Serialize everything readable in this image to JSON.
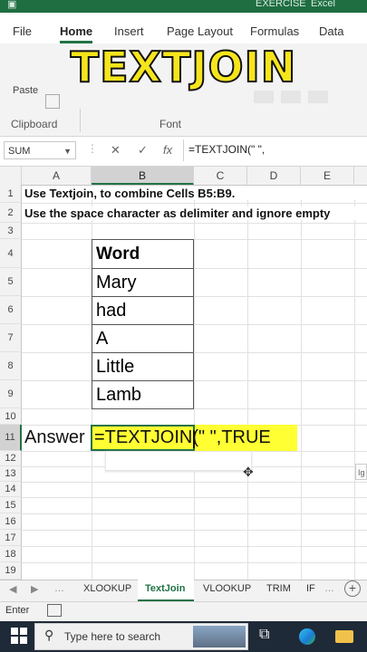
{
  "titlebar": {
    "filename": "EXERCISE",
    "app": "Excel"
  },
  "ribbon": {
    "tabs": [
      "File",
      "Home",
      "Insert",
      "Page Layout",
      "Formulas",
      "Data"
    ],
    "banner": "TEXTJOIN",
    "paste_label": "Paste",
    "groups": {
      "clipboard": "Clipboard",
      "font": "Font"
    }
  },
  "formula_bar": {
    "name_box": "SUM",
    "cancel": "✕",
    "enter": "✓",
    "fx": "fx",
    "formula": "=TEXTJOIN(\" \","
  },
  "grid": {
    "columns": [
      "A",
      "B",
      "C",
      "D",
      "E"
    ],
    "rows": [
      "1",
      "2",
      "3",
      "4",
      "5",
      "6",
      "7",
      "8",
      "9",
      "10",
      "11",
      "12",
      "13",
      "14",
      "15",
      "16",
      "17",
      "18",
      "19"
    ],
    "row1": "Use Textjoin, to combine Cells B5:B9.",
    "row2": "Use the space character as delimiter and ignore empty",
    "header": "Word",
    "words": [
      "Mary",
      "had",
      "A",
      "Little",
      "Lamb"
    ],
    "answer_label": "Answer",
    "answer_formula": "=TEXTJOIN(\" \",TRUE",
    "tooltip_hint": "Ig"
  },
  "sheets": {
    "tabs": [
      "XLOOKUP",
      "TextJoin",
      "VLOOKUP",
      "TRIM",
      "IF"
    ],
    "active": "TextJoin"
  },
  "status": {
    "mode": "Enter"
  },
  "taskbar": {
    "search_placeholder": "Type here to search"
  },
  "colors": {
    "excel_green": "#217346",
    "highlight": "#ffff33",
    "banner_yellow": "#f6e51c"
  }
}
